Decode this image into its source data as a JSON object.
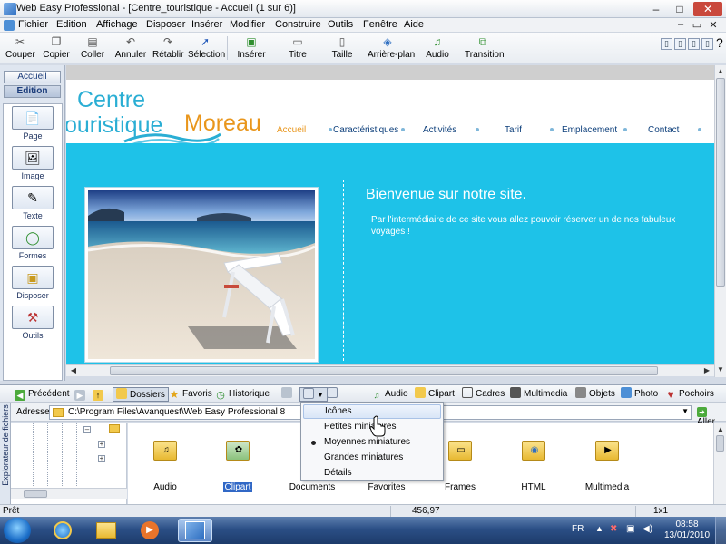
{
  "window": {
    "title": "Web Easy Professional - [Centre_touristique - Accueil (1 sur 6)]",
    "minimize": "–",
    "maximize": "□",
    "close": "✕"
  },
  "menubar": {
    "items": [
      "Fichier",
      "Edition",
      "Affichage",
      "Disposer",
      "Insérer",
      "Modifier",
      "Construire",
      "Outils",
      "Fenêtre",
      "Aide"
    ],
    "mdi_min": "–",
    "mdi_max": "▭",
    "mdi_close": "✕"
  },
  "toolbar": {
    "buttons": [
      "Couper",
      "Copier",
      "Coller",
      "Annuler",
      "Rétablir",
      "Sélection",
      "Insérer",
      "Titre",
      "Taille",
      "Arrière-plan",
      "Audio",
      "Transition"
    ]
  },
  "leftpanel": {
    "tabs": [
      "Accueil",
      "Edition"
    ],
    "tools": [
      "Page",
      "Image",
      "Texte",
      "Formes",
      "Disposer",
      "Outils"
    ]
  },
  "site": {
    "logo_line1": "Centre",
    "logo_line2": "ouristique",
    "logo_line3": "Moreau",
    "nav": [
      "Accueil",
      "Caractéristiques",
      "Activités",
      "Tarif",
      "Emplacement",
      "Contact"
    ],
    "welcome_title": "Bienvenue sur notre site.",
    "welcome_text": "Par l'intermédiaire de ce site vous allez pouvoir réserver un de nos fabuleux voyages !",
    "colors": {
      "accent": "#1ec2e8",
      "logo_blue": "#2aaed4",
      "logo_orange": "#e9961c"
    }
  },
  "explorer": {
    "side_label": "Explorateur de fichiers",
    "toolbar": {
      "back": "Précédent",
      "folders": "Dossiers",
      "favorites": "Favoris",
      "history": "Historique",
      "audio": "Audio",
      "clipart": "Clipart",
      "frames": "Cadres",
      "multimedia": "Multimedia",
      "objects": "Objets",
      "photo": "Photo",
      "brushes": "Pochoirs"
    },
    "address_label": "Adresse",
    "address_value": "C:\\Program Files\\Avanquest\\Web Easy Professional 8",
    "go_label": "Aller",
    "files": [
      "Audio",
      "Clipart",
      "Documents",
      "Favorites",
      "Frames",
      "HTML",
      "Multimedia"
    ],
    "selected_file": "Clipart",
    "view_menu": {
      "items": [
        "Icônes",
        "Petites miniatures",
        "Moyennes miniatures",
        "Grandes miniatures",
        "Détails"
      ],
      "hovered": "Icônes",
      "checked": "Moyennes miniatures"
    }
  },
  "statusbar": {
    "status": "Prêt",
    "coords": "456,97",
    "size": "1x1"
  },
  "taskbar": {
    "lang": "FR",
    "time": "08:58",
    "date": "13/01/2010"
  }
}
